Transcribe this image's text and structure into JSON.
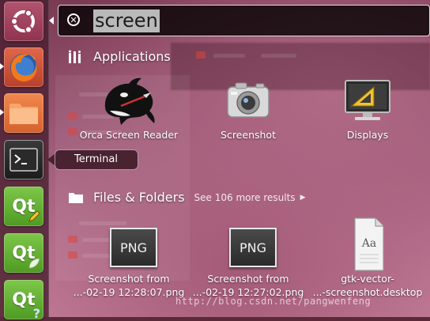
{
  "search": {
    "query": "screen"
  },
  "sections": {
    "applications": {
      "title": "Applications"
    },
    "files": {
      "title": "Files & Folders",
      "see_more": "See 106 more results"
    }
  },
  "apps": [
    {
      "label": "Orca Screen Reader",
      "icon": "orca-icon"
    },
    {
      "label": "Screenshot",
      "icon": "camera-icon"
    },
    {
      "label": "Displays",
      "icon": "display-icon"
    }
  ],
  "files": [
    {
      "line1": "Screenshot from",
      "line2": "...-02-19 12:28:07.png",
      "icon_text": "PNG"
    },
    {
      "line1": "Screenshot from",
      "line2": "...-02-19 12:27:02.png",
      "icon_text": "PNG"
    },
    {
      "line1": "gtk-vector-",
      "line2": "...-screenshot.desktop",
      "icon_text": "Aa"
    }
  ],
  "launcher": {
    "tooltip": "Terminal",
    "items": [
      "dash-home",
      "firefox",
      "files",
      "terminal",
      "qt-creator",
      "qt-designer",
      "qt-assistant"
    ],
    "qt_label": "Qt"
  },
  "watermark": "http://blog.csdn.net/pangwenfeng"
}
